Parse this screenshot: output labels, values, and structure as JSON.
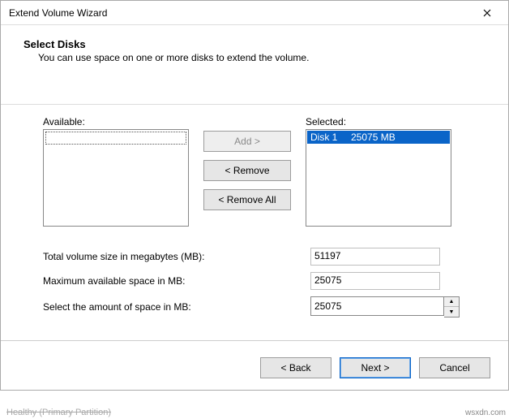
{
  "window": {
    "title": "Extend Volume Wizard"
  },
  "heading": "Select Disks",
  "subtext": "You can use space on one or more disks to extend the volume.",
  "labels": {
    "available": "Available:",
    "selected": "Selected:"
  },
  "buttons": {
    "add": "Add >",
    "remove": "< Remove",
    "remove_all": "< Remove All",
    "back": "< Back",
    "next": "Next >",
    "cancel": "Cancel"
  },
  "selected_list": {
    "item0": "Disk 1     25075 MB"
  },
  "fields": {
    "total_label": "Total volume size in megabytes (MB):",
    "total_value": "51197",
    "max_label": "Maximum available space in MB:",
    "max_value": "25075",
    "amount_label": "Select the amount of space in MB:",
    "amount_value": "25075"
  },
  "watermark": "wsxdn.com",
  "bg_text": "Healthy (Primary Partition)"
}
